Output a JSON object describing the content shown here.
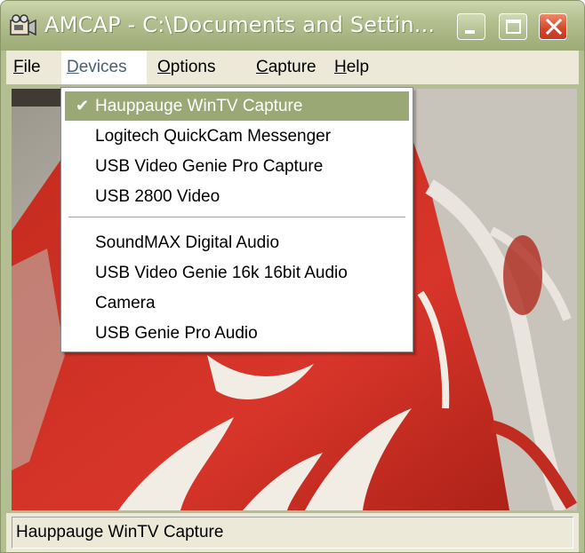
{
  "window": {
    "title": "AMCAP - C:\\Documents and Settin..."
  },
  "menubar": {
    "items": [
      {
        "label_underlined": "F",
        "label_rest": "ile"
      },
      {
        "label_underlined": "D",
        "label_rest": "evices"
      },
      {
        "label_underlined": "O",
        "label_rest": "ptions"
      },
      {
        "label_underlined": "C",
        "label_rest": "apture"
      },
      {
        "label_underlined": "H",
        "label_rest": "elp"
      }
    ]
  },
  "devices_menu": {
    "check_glyph": "✔",
    "video_devices": [
      "Hauppauge WinTV Capture",
      "Logitech QuickCam Messenger",
      "USB Video Genie Pro Capture",
      "USB 2800 Video"
    ],
    "audio_devices": [
      "SoundMAX Digital Audio",
      "USB Video Genie 16k 16bit Audio",
      "Camera",
      "USB Genie Pro Audio"
    ],
    "selected_index": 0
  },
  "statusbar": {
    "text": "Hauppauge WinTV Capture"
  },
  "colors": {
    "title_bar": "#a8b583",
    "menu_highlight": "#9aa876",
    "close_button": "#d0462c",
    "menu_background": "#ece9d8"
  },
  "icons": {
    "app": "camera-app-icon",
    "minimize": "minimize-icon",
    "maximize": "maximize-icon",
    "close": "close-icon",
    "checkmark": "checkmark-icon"
  }
}
